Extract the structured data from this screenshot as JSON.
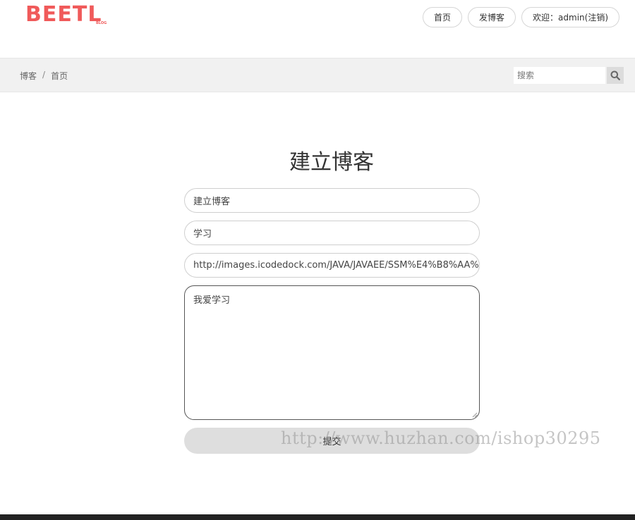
{
  "header": {
    "logo_text": "BEETL",
    "logo_sub": "BLOG",
    "nav": [
      {
        "label": "首页"
      },
      {
        "label": "发博客"
      },
      {
        "label": "欢迎：admin(注销)"
      }
    ]
  },
  "breadcrumb": {
    "items": [
      "博客",
      "首页"
    ],
    "separator": "/"
  },
  "search": {
    "placeholder": "搜索",
    "icon": "search-icon"
  },
  "form": {
    "title": "建立博客",
    "title_field": "建立博客",
    "category_field": "学习",
    "image_url_field": "http://images.icodedock.com/JAVA/JAVAEE/SSM%E4%B8%AA%",
    "content": "我爱学习",
    "submit_label": "提交"
  },
  "watermark": "http://www.huzhan.com/ishop30295",
  "colors": {
    "brand": "#f05a5a",
    "crumbbar_bg": "#f1f1f1",
    "submit_bg": "#dedede",
    "footer_bg": "#222222"
  }
}
